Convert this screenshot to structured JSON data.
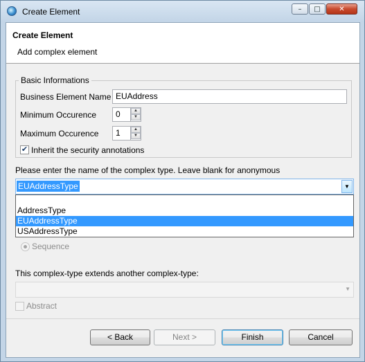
{
  "window": {
    "title": "Create Element",
    "controls": {
      "minimize": "–",
      "maximize": "□",
      "close": "✕"
    }
  },
  "header": {
    "title": "Create Element",
    "subtitle": "Add complex element"
  },
  "basic": {
    "legend": "Basic Informations",
    "name_label": "Business Element Name",
    "name_value": "EUAddress",
    "min_label": "Minimum Occurence",
    "min_value": "0",
    "max_label": "Maximum Occurence",
    "max_value": "1",
    "inherit_label": "Inherit the security annotations",
    "inherit_checked": true
  },
  "complex_type": {
    "prompt": "Please enter the name of the complex type. Leave blank for anonymous",
    "value": "EUAddressType",
    "options": [
      "",
      "AddressType",
      "EUAddressType",
      "USAddressType"
    ],
    "selected_index": 2
  },
  "group_type": {
    "sequence_label": "Sequence"
  },
  "extends": {
    "label": "This complex-type extends another complex-type:",
    "value": "",
    "abstract_label": "Abstract"
  },
  "buttons": {
    "back": "< Back",
    "next": "Next >",
    "finish": "Finish",
    "cancel": "Cancel"
  },
  "icons": {
    "app": "talend-app-icon",
    "spin_up": "▲",
    "spin_down": "▼",
    "combo_arrow": "▼",
    "check": "✔"
  }
}
